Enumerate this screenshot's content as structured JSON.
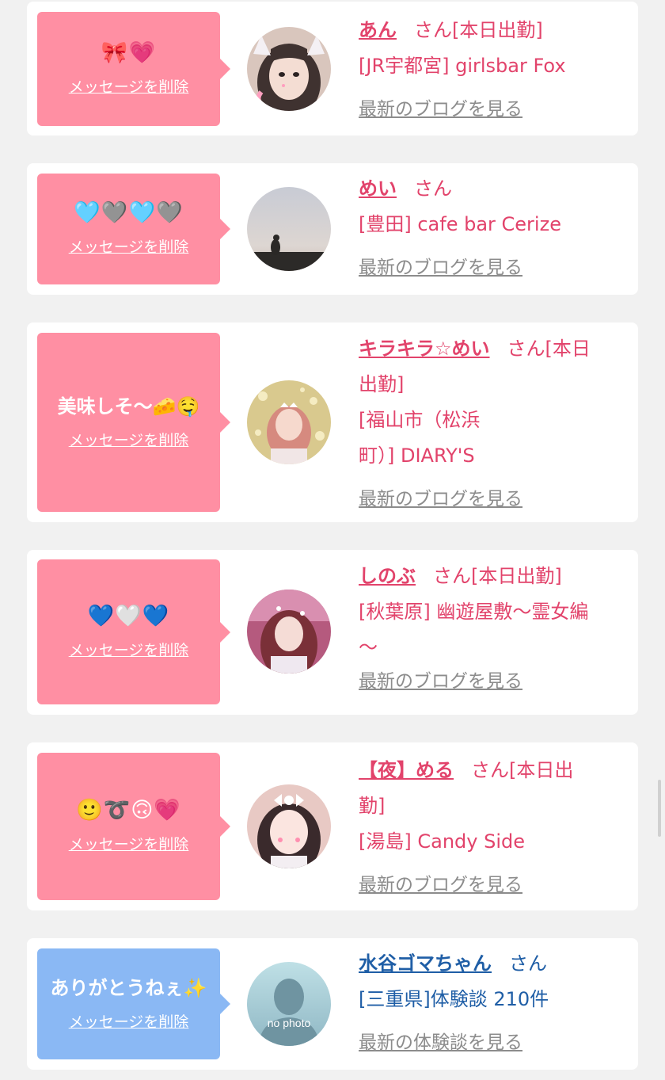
{
  "entries": [
    {
      "message": "🎀💗",
      "delete_label": "メッセージを削除",
      "name": "あん",
      "san_status": "さん[本日出勤]",
      "shop_lines": [
        "[JR宇都宮] girlsbar Fox"
      ],
      "blog_link": "最新のブログを見る",
      "bubble_color": "#ff8fa3"
    },
    {
      "message": "🩵🩶🩵🩶",
      "delete_label": "メッセージを削除",
      "name": "めい",
      "san_status": "さん",
      "shop_lines": [
        "[豊田] cafe bar Cerize"
      ],
      "blog_link": "最新のブログを見る",
      "bubble_color": "#ff8fa3"
    },
    {
      "message": "美味しそ〜🧀🤤",
      "delete_label": "メッセージを削除",
      "name": "キラキラ☆めい",
      "san_status": "さん[本日",
      "status_cont": "出勤]",
      "shop_lines": [
        "[福山市（松浜",
        "町）] DIARY'S"
      ],
      "blog_link": "最新のブログを見る",
      "bubble_color": "#ff8fa3"
    },
    {
      "message": "💙🤍💙",
      "delete_label": "メッセージを削除",
      "name": "しのぶ",
      "san_status": "さん[本日出勤]",
      "shop_lines": [
        "[秋葉原] 幽遊屋敷〜霊女編",
        "〜"
      ],
      "blog_link": "最新のブログを見る",
      "bubble_color": "#ff8fa3"
    },
    {
      "message": "🙂➰🙃💗",
      "delete_label": "メッセージを削除",
      "name": "【夜】める",
      "san_status": "さん[本日出",
      "status_cont": "勤]",
      "shop_lines": [
        "[湯島] Candy Side"
      ],
      "blog_link": "最新のブログを見る",
      "bubble_color": "#ff8fa3"
    },
    {
      "message": "ありがとうねぇ✨",
      "delete_label": "メッセージを削除",
      "name": "水谷ゴマちゃん",
      "san_status": "さん",
      "shop_lines": [
        "[三重県]体験談 210件"
      ],
      "blog_link": "最新の体験談を見る",
      "bubble_color": "#8ab8f4",
      "avatar_text": "no photo"
    }
  ],
  "colors": {
    "name_pink": "#e2436b",
    "name_blue": "#1f5ea6",
    "link_gray": "#8c8c8c"
  }
}
